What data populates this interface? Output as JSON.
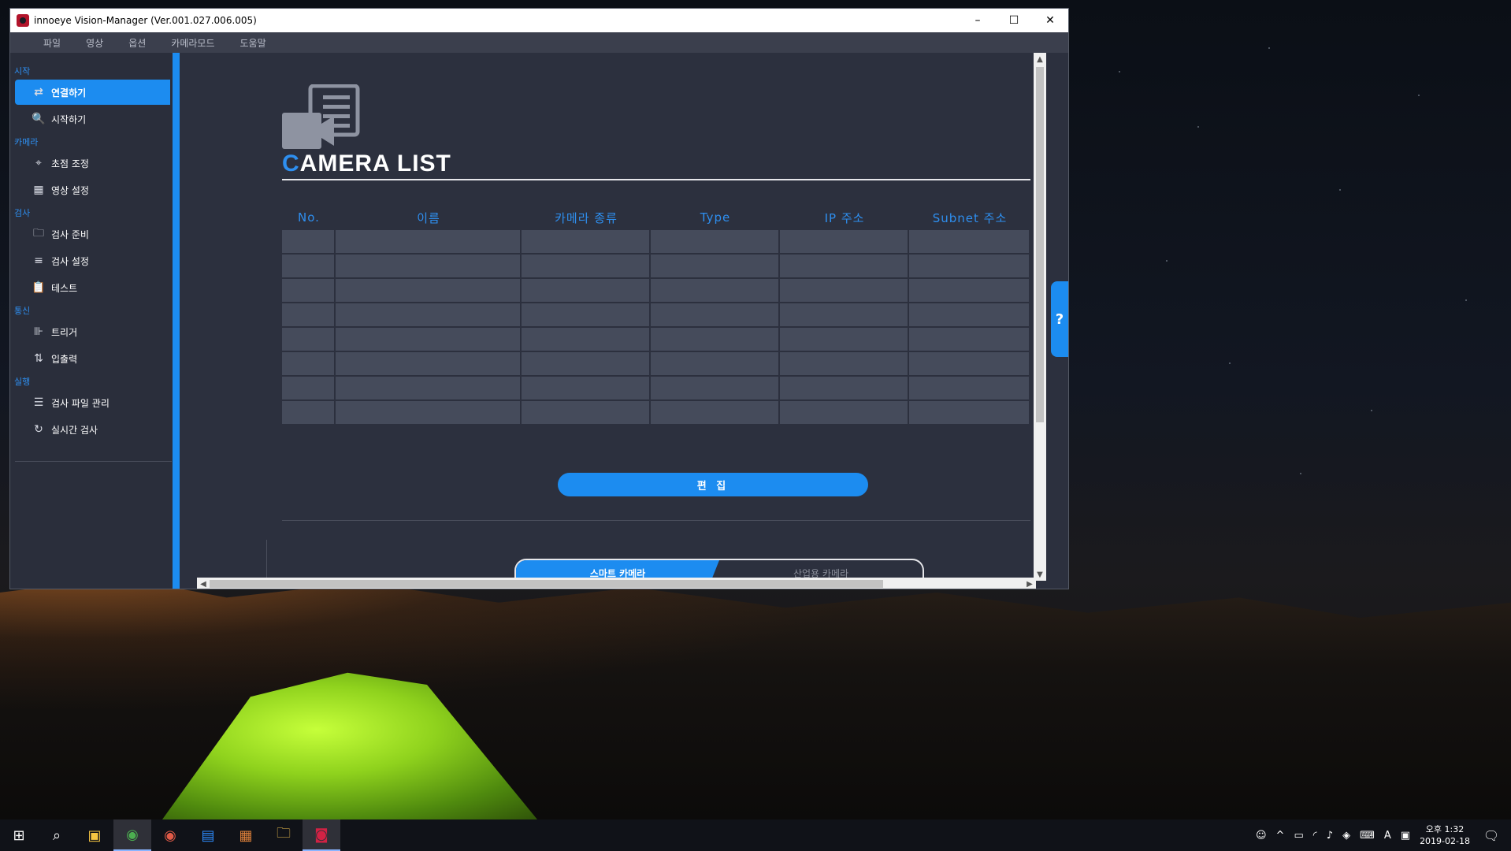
{
  "window": {
    "title": "innoeye Vision-Manager (Ver.001.027.006.005)",
    "controls": {
      "minimize": "–",
      "maximize": "☐",
      "close": "✕"
    }
  },
  "menu": [
    "파일",
    "영상",
    "옵션",
    "카메라모드",
    "도움말"
  ],
  "sidebar": {
    "sections": [
      {
        "label": "시작",
        "items": [
          {
            "label": "연결하기",
            "icon": "connect-arrows-icon",
            "glyph": "⇄",
            "active": true
          },
          {
            "label": "시작하기",
            "icon": "search-icon",
            "glyph": "🔍",
            "active": false
          }
        ]
      },
      {
        "label": "카메라",
        "items": [
          {
            "label": "초점 조정",
            "icon": "focus-icon",
            "glyph": "⌖",
            "active": false
          },
          {
            "label": "영상 설정",
            "icon": "image-settings-icon",
            "glyph": "▦",
            "active": false
          }
        ]
      },
      {
        "label": "검사",
        "items": [
          {
            "label": "검사 준비",
            "icon": "folder-icon",
            "glyph": "🗀",
            "active": false
          },
          {
            "label": "검사 설정",
            "icon": "checklist-icon",
            "glyph": "≡",
            "active": false
          },
          {
            "label": "테스트",
            "icon": "clipboard-icon",
            "glyph": "📋",
            "active": false
          }
        ]
      },
      {
        "label": "통신",
        "items": [
          {
            "label": "트리거",
            "icon": "trigger-icon",
            "glyph": "⊪",
            "active": false
          },
          {
            "label": "입출력",
            "icon": "io-icon",
            "glyph": "⇅",
            "active": false
          }
        ]
      },
      {
        "label": "실행",
        "items": [
          {
            "label": "검사 파일 관리",
            "icon": "list-icon",
            "glyph": "☰",
            "active": false
          },
          {
            "label": "실시간 검사",
            "icon": "realtime-icon",
            "glyph": "↻",
            "active": false
          }
        ]
      }
    ],
    "collapse_glyph": "◀"
  },
  "main": {
    "title_first_letter": "C",
    "title_rest": "AMERA LIST",
    "table": {
      "headers": [
        "No.",
        "이름",
        "카메라 종류",
        "Type",
        "IP 주소",
        "Subnet 주소"
      ],
      "rows": [
        [
          "",
          "",
          "",
          "",
          "",
          ""
        ],
        [
          "",
          "",
          "",
          "",
          "",
          ""
        ],
        [
          "",
          "",
          "",
          "",
          "",
          ""
        ],
        [
          "",
          "",
          "",
          "",
          "",
          ""
        ],
        [
          "",
          "",
          "",
          "",
          "",
          ""
        ],
        [
          "",
          "",
          "",
          "",
          "",
          ""
        ],
        [
          "",
          "",
          "",
          "",
          "",
          ""
        ],
        [
          "",
          "",
          "",
          "",
          "",
          ""
        ]
      ]
    },
    "edit_button": "편 집",
    "toggle": {
      "smart": "스마트 카메라",
      "industrial": "산업용 카메라",
      "selected": "smart"
    },
    "help_label": "?"
  },
  "taskbar": {
    "time": "오후 1:32",
    "date": "2019-02-18",
    "ime": "A",
    "notifications": "1"
  },
  "colors": {
    "accent": "#1c8cf0",
    "background": "#2c303e",
    "cell": "#454b5b"
  }
}
